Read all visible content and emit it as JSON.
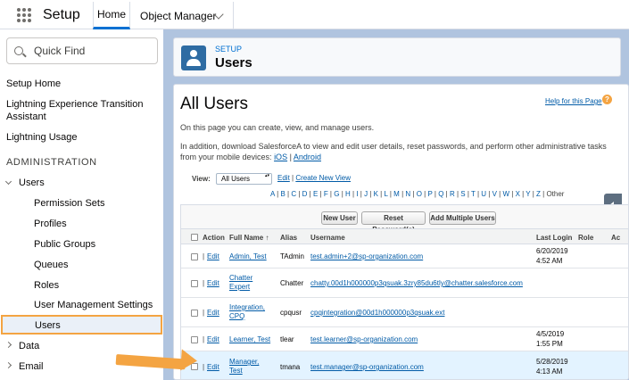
{
  "app": {
    "name": "Setup"
  },
  "tabs": [
    {
      "label": "Home"
    },
    {
      "label": "Object Manager"
    }
  ],
  "sidebar": {
    "search_placeholder": "Quick Find",
    "items": [
      {
        "label": "Setup Home"
      },
      {
        "label": "Lightning Experience Transition Assistant"
      },
      {
        "label": "Lightning Usage"
      }
    ],
    "section_heading": "ADMINISTRATION",
    "users_group": "Users",
    "users_children": [
      "Permission Sets",
      "Profiles",
      "Public Groups",
      "Queues",
      "Roles",
      "User Management Settings",
      "Users"
    ],
    "data_group": "Data",
    "email_group": "Email"
  },
  "header": {
    "breadcrumb": "SETUP",
    "title": "Users"
  },
  "main": {
    "heading": "All Users",
    "help_link": "Help for this Page",
    "help_icon": "?",
    "intro": "On this page you can create, view, and manage users.",
    "download_text": "In addition, download SalesforceA to view and edit user details, reset passwords, and perform other administrative tasks from your mobile devices:",
    "ios_link": "iOS",
    "android_link": "Android",
    "view_label": "View:",
    "view_value": "All Users",
    "edit_link": "Edit",
    "create_view_link": "Create New View",
    "letters": [
      "A",
      "B",
      "C",
      "D",
      "E",
      "F",
      "G",
      "H",
      "I",
      "J",
      "K",
      "L",
      "M",
      "N",
      "O",
      "P",
      "Q",
      "R",
      "S",
      "T",
      "U",
      "V",
      "W",
      "X",
      "Y",
      "Z",
      "Other"
    ],
    "buttons": {
      "new_user": "New User",
      "reset_passwords": "Reset Password(s)",
      "add_multiple": "Add Multiple Users"
    },
    "columns": [
      "Action",
      "Full Name",
      "Alias",
      "Username",
      "Last Login",
      "Role",
      "Ac"
    ],
    "sort_indicator": "↑",
    "edit_label": "Edit",
    "rows": [
      {
        "full_name": "Admin, Test",
        "alias": "TAdmin",
        "username": "test.admin+2@sp-organization.com",
        "last_login_date": "6/20/2019",
        "last_login_time": "4:52 AM"
      },
      {
        "full_name": "Chatter Expert",
        "alias": "Chatter",
        "username": "chatty.00d1h000000p3qsuak.3zry85du6tly@chatter.salesforce.com",
        "last_login_date": "",
        "last_login_time": ""
      },
      {
        "full_name": "Integration, CPQ",
        "alias": "cpqusr",
        "username": "cpqintegration@00d1h000000p3qsuak.ext",
        "last_login_date": "",
        "last_login_time": ""
      },
      {
        "full_name": "Learner, Test",
        "alias": "tlear",
        "username": "test.learner@sp-organization.com",
        "last_login_date": "4/5/2019",
        "last_login_time": "1:55 PM"
      },
      {
        "full_name": "Manager, Test",
        "alias": "tmana",
        "username": "test.manager@sp-organization.com",
        "last_login_date": "5/28/2019",
        "last_login_time": "4:13 AM"
      }
    ]
  },
  "colors": {
    "accent": "#0070d2",
    "highlight_border": "#f4a442",
    "background": "#b0c4df"
  }
}
